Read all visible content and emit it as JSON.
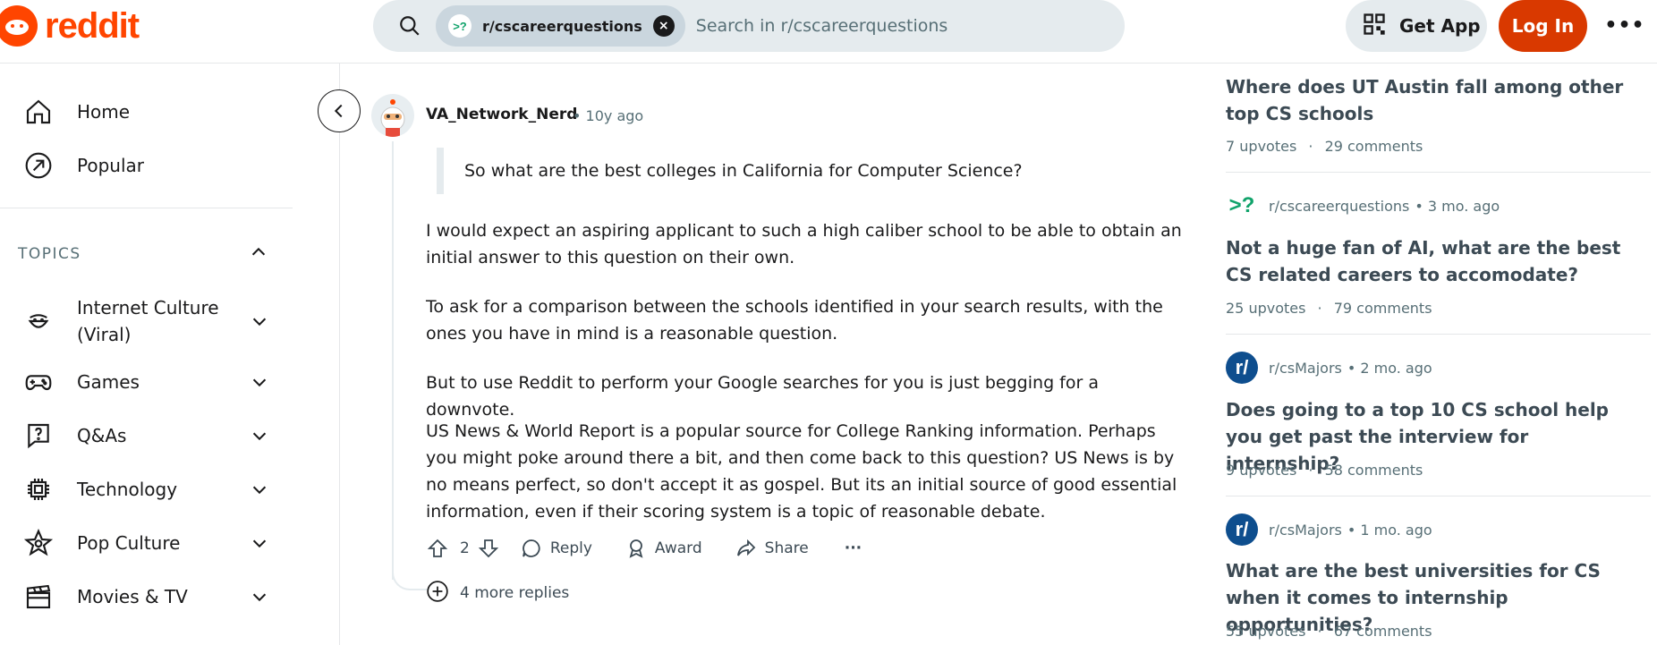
{
  "header": {
    "logo_text": "reddit",
    "search": {
      "chip_icon": ">?",
      "chip_label": "r/cscareerquestions",
      "placeholder": "Search in r/cscareerquestions"
    },
    "get_app_label": "Get App",
    "login_label": "Log In",
    "more_label": "•••"
  },
  "sidebar": {
    "nav": [
      {
        "label": "Home",
        "icon": "home-icon"
      },
      {
        "label": "Popular",
        "icon": "popular-icon"
      }
    ],
    "topics_label": "TOPICS",
    "topics": [
      {
        "label": "Internet Culture (Viral)",
        "icon": "smile-icon"
      },
      {
        "label": "Games",
        "icon": "gamepad-icon"
      },
      {
        "label": "Q&As",
        "icon": "question-icon"
      },
      {
        "label": "Technology",
        "icon": "chip-icon"
      },
      {
        "label": "Pop Culture",
        "icon": "star-icon"
      },
      {
        "label": "Movies & TV",
        "icon": "clapperboard-icon"
      }
    ]
  },
  "comment": {
    "author": "VA_Network_Nerd",
    "time": "• 10y ago",
    "quote": "So what are the best colleges in California for Computer Science?",
    "paragraphs": [
      "I would expect an aspiring applicant to such a high caliber school to be able to obtain an initial answer to this question on their own.",
      "To ask for a comparison between the schools identified in your search results, with the ones you have in mind is a reasonable question.",
      "But to use Reddit to perform your Google searches for you is just begging for a downvote.",
      "US News & World Report is a popular source for College Ranking information. Perhaps you might poke around there a bit, and then come back to this question? US News is by no means perfect, so don't accept it as gospel. But its an initial source of good essential information, even if their scoring system is a topic of reasonable debate."
    ],
    "score": "2",
    "reply_label": "Reply",
    "award_label": "Award",
    "share_label": "Share",
    "more_label": "···",
    "more_replies_label": "4 more replies"
  },
  "related": [
    {
      "title": "Where does UT Austin fall among other top CS schools",
      "upvotes": "7 upvotes",
      "comments": "29 comments"
    },
    {
      "subreddit": "r/cscareerquestions",
      "sub_icon": ">?",
      "age": "• 3 mo. ago",
      "title": "Not a huge fan of AI, what are the best CS related careers to accomodate?",
      "upvotes": "25 upvotes",
      "comments": "79 comments"
    },
    {
      "subreddit": "r/csMajors",
      "sub_icon": "r/",
      "age": "• 2 mo. ago",
      "title": "Does going to a top 10 CS school help you get past the interview for internship?",
      "upvotes": "9 upvotes",
      "comments": "58 comments"
    },
    {
      "subreddit": "r/csMajors",
      "sub_icon": "r/",
      "age": "• 1 mo. ago",
      "title": "What are the best universities for CS when it comes to internship opportunities?",
      "upvotes": "55 upvotes",
      "comments": "67 comments"
    }
  ],
  "meta_separator": "·",
  "colors": {
    "brand": "#ff4500",
    "login_bg": "#d93900",
    "search_bg": "#e5ebee",
    "chip_bg": "#cad6de",
    "muted_text": "#576f76",
    "sub_green": "#11a36b",
    "sub_blue": "#0e4e8e"
  }
}
